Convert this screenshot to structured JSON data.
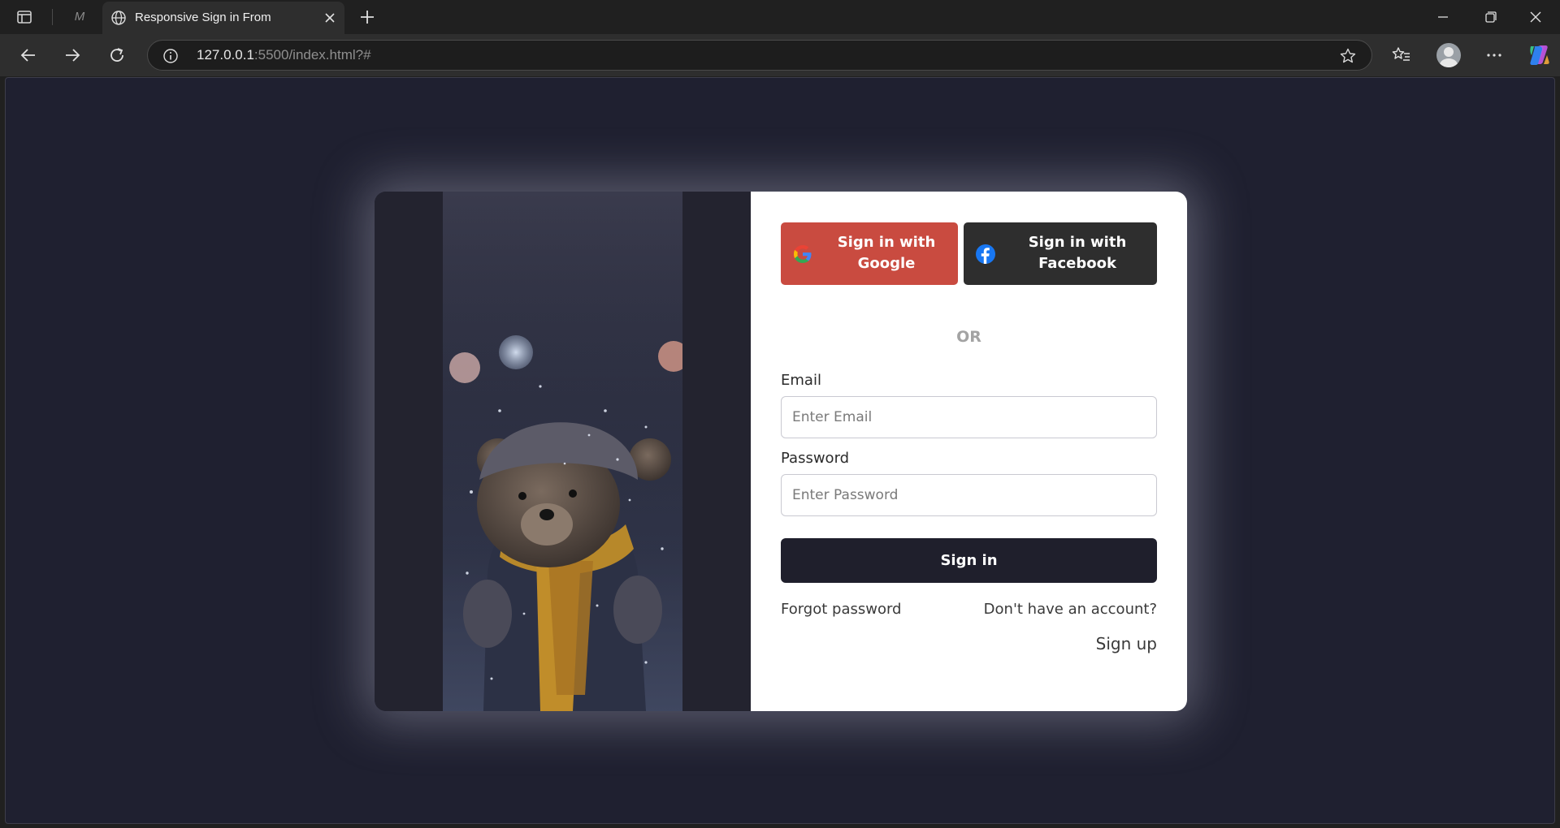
{
  "browser": {
    "inactive_tab_label": "M",
    "active_tab_title": "Responsive Sign in From",
    "url_host": "127.0.0.1",
    "url_rest": ":5500/index.html?#"
  },
  "page": {
    "background_color": "#1f2030",
    "google_button_label": "Sign in with Google",
    "facebook_button_label": "Sign in with Facebook",
    "or_label": "OR",
    "email_label": "Email",
    "email_placeholder": "Enter Email",
    "password_label": "Password",
    "password_placeholder": "Enter Password",
    "signin_button_label": "Sign in",
    "forgot_password_label": "Forgot password",
    "no_account_label": "Don't have an account?",
    "signup_label": "Sign up",
    "colors": {
      "google_red": "#c94b40",
      "facebook_dark": "#2e2e2e",
      "signin_dark": "#1f1f2c"
    },
    "image_subject": "teddy-bear-in-snow-photo"
  }
}
